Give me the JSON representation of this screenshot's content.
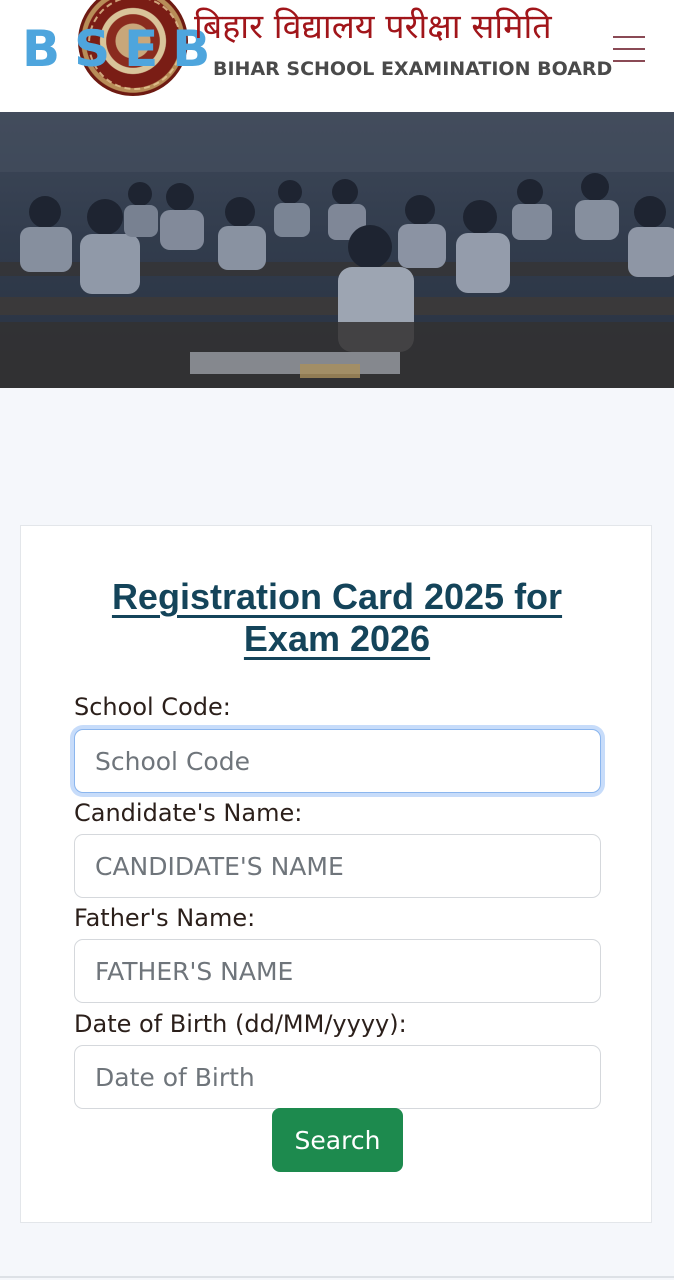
{
  "header": {
    "logo_text": "BSEB",
    "hindi_title": "बिहार विद्यालय परीक्षा समिति",
    "english_title": "BIHAR SCHOOL EXAMINATION BOARD",
    "menu_icon": "hamburger-menu-icon",
    "seal_icon": "bseb-seal-emblem"
  },
  "banner": {
    "image": "classroom-exam-students-photo"
  },
  "form": {
    "title_line1": "Registration Card 2025 for",
    "title_line2": "Exam 2026",
    "school_code_label": "School Code:",
    "school_code_placeholder": "School Code",
    "school_code_value": "",
    "candidate_name_label": "Candidate's Name:",
    "candidate_name_placeholder": "CANDIDATE'S NAME",
    "candidate_name_value": "",
    "father_name_label": "Father's Name:",
    "father_name_placeholder": "FATHER'S NAME",
    "father_name_value": "",
    "dob_label": "Date of Birth (dd/MM/yyyy):",
    "dob_placeholder": "Date of Birth",
    "dob_value": "",
    "search_label": "Search"
  },
  "colors": {
    "logo_blue": "#4ea5dd",
    "hindi_red": "#a1151a",
    "title_navy": "#14445a",
    "button_green": "#1d8a4e",
    "focus_ring": "#c7dcfa"
  }
}
